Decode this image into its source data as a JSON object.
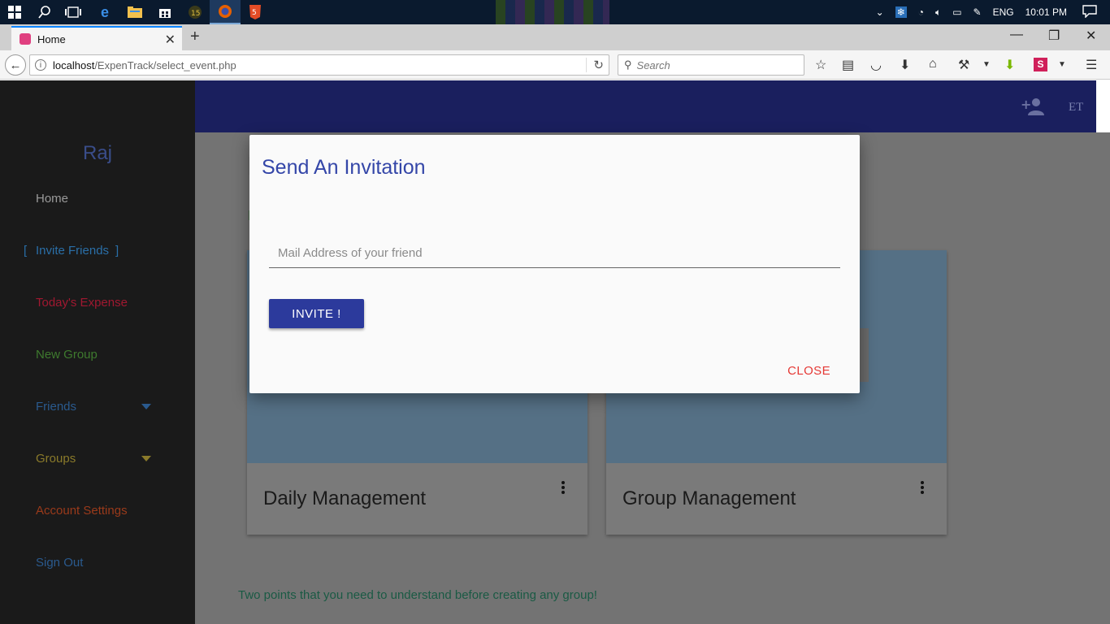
{
  "taskbar": {
    "start_icon": "windows-logo-icon",
    "language": "ENG",
    "time": "10:01 PM"
  },
  "browser": {
    "tab_title": "Home",
    "url_host": "localhost",
    "url_path": "/ExpenTrack/select_event.php",
    "search_placeholder": "Search"
  },
  "sidebar": {
    "user_name": "Raj",
    "items": [
      {
        "label": "Home",
        "color": "#9a9a9a"
      },
      {
        "label": "Invite Friends",
        "color": "#2a6fa8",
        "bracket_open": "[",
        "bracket_close": "]"
      },
      {
        "label": "Today's Expense",
        "color": "#a01830"
      },
      {
        "label": "New Group",
        "color": "#3e7a2e"
      },
      {
        "label": "Friends",
        "color": "#2a5a8e"
      },
      {
        "label": "Groups",
        "color": "#8a7a2a"
      },
      {
        "label": "Account Settings",
        "color": "#9a3a1a"
      },
      {
        "label": "Sign Out",
        "color": "#2a5a8e"
      }
    ]
  },
  "header": {
    "add_user_icon": "add-person-icon",
    "initials": "ET"
  },
  "cards": [
    {
      "title": "Daily Management"
    },
    {
      "title": "Group Management"
    }
  ],
  "info_text": "Two points that you need to understand before creating any group!",
  "modal": {
    "title": "Send An Invitation",
    "input_placeholder": "Mail Address of your friend",
    "invite_label": "INVITE !",
    "close_label": "CLOSE"
  },
  "colors": {
    "accent": "#2c3a9c",
    "modal_title": "#3446a8",
    "close": "#e53935",
    "header": "#1a1f5e"
  }
}
